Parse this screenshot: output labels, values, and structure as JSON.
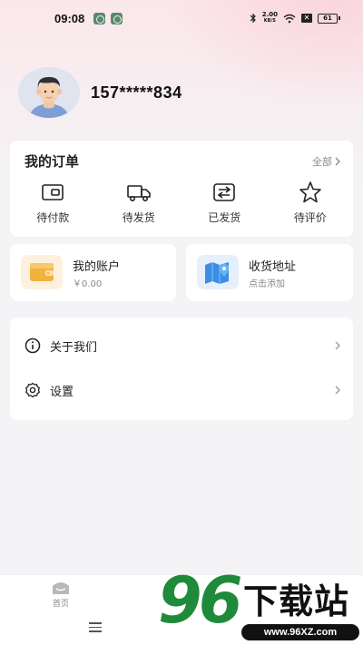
{
  "status_bar": {
    "time": "09:08",
    "net_speed_value": "2.00",
    "net_speed_unit": "KB/S",
    "battery": "61"
  },
  "profile": {
    "phone": "157*****834"
  },
  "orders": {
    "title": "我的订单",
    "all_label": "全部",
    "items": [
      {
        "label": "待付款",
        "icon": "wallet-icon"
      },
      {
        "label": "待发货",
        "icon": "truck-icon"
      },
      {
        "label": "已发货",
        "icon": "shipped-icon"
      },
      {
        "label": "待评价",
        "icon": "star-icon"
      }
    ]
  },
  "account": {
    "title": "我的账户",
    "balance": "￥0.00"
  },
  "address": {
    "title": "收货地址",
    "subtitle": "点击添加"
  },
  "menu": {
    "items": [
      {
        "label": "关于我们",
        "icon": "info-icon"
      },
      {
        "label": "设置",
        "icon": "gear-icon"
      }
    ]
  },
  "bottom_nav": {
    "home_label": "首页"
  },
  "watermark": {
    "number": "96",
    "text": "下载站",
    "url": "www.96XZ.com"
  },
  "colors": {
    "accent_orange": "#f3b13f",
    "accent_blue": "#3a8ee6",
    "watermark_green": "#1f8a3a"
  }
}
